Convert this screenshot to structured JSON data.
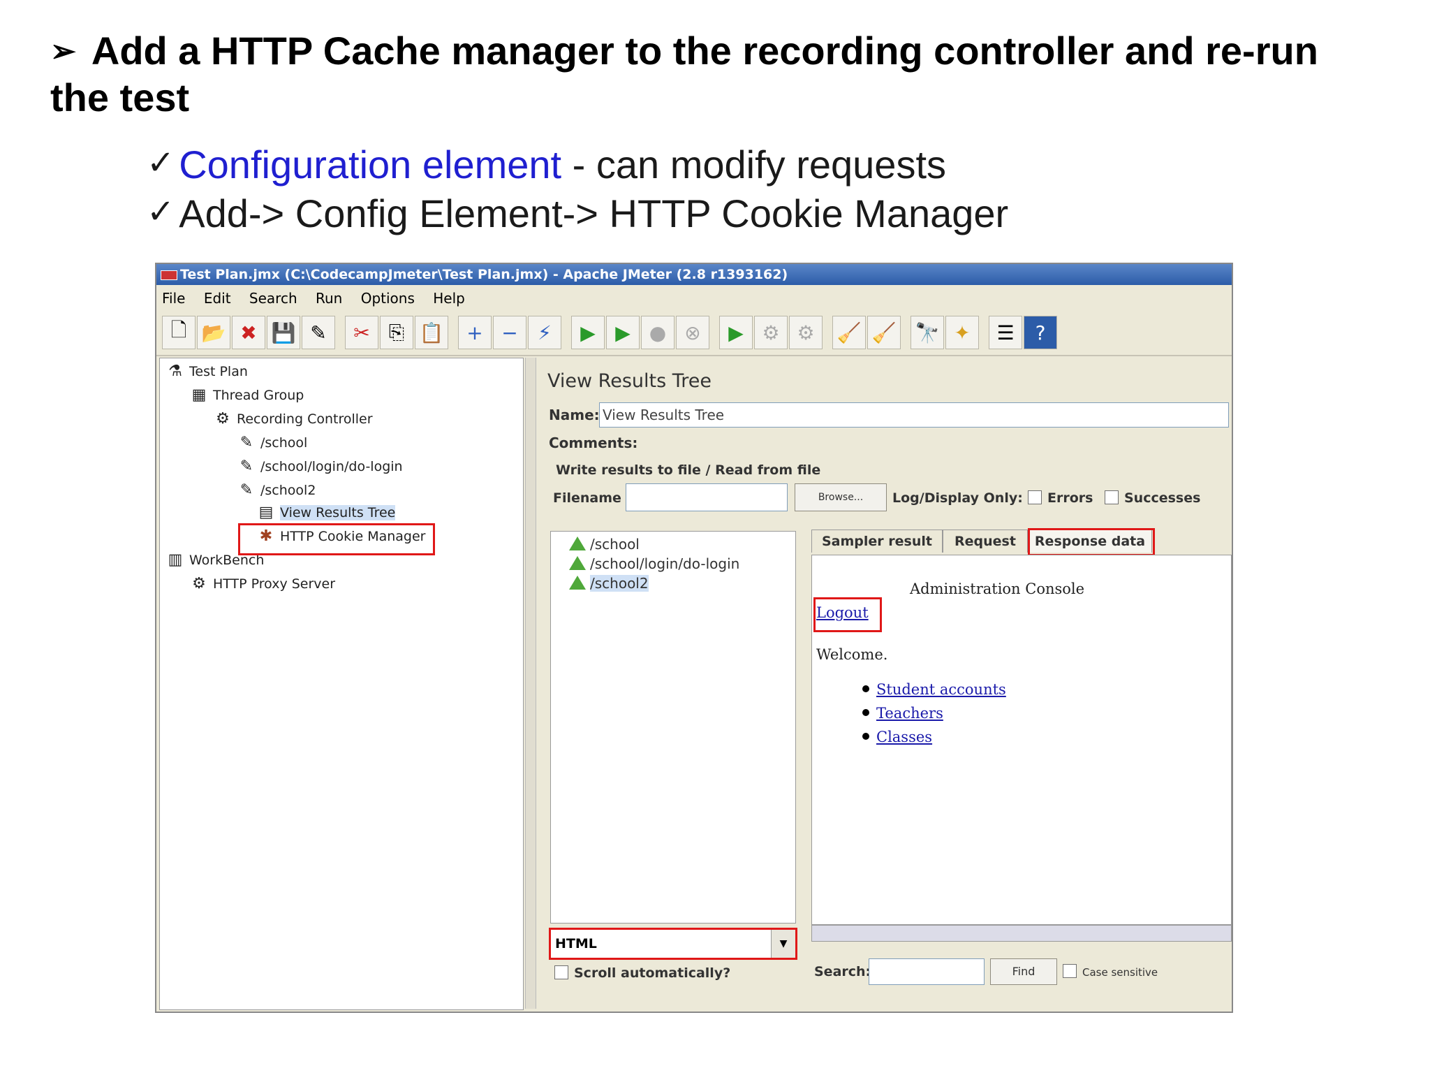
{
  "slide": {
    "heading_marker": "➢",
    "heading": "Add a HTTP Cache manager to the recording controller  and re-run the test",
    "bullets": [
      {
        "check": "✓",
        "highlight": "Configuration element",
        "rest": " - can modify requests"
      },
      {
        "check": "✓",
        "highlight": "",
        "rest": "Add-> Config Element-> HTTP Cookie Manager"
      }
    ]
  },
  "window": {
    "title": "Test Plan.jmx (C:\\CodecampJmeter\\Test Plan.jmx) - Apache JMeter (2.8 r1393162)",
    "menu": [
      "File",
      "Edit",
      "Search",
      "Run",
      "Options",
      "Help"
    ],
    "toolbar_icons": [
      "new-icon",
      "open-icon",
      "close-icon",
      "save-icon",
      "save-as-icon",
      "cut-icon",
      "copy-icon",
      "paste-icon",
      "expand-icon",
      "collapse-icon",
      "toggle-icon",
      "start-icon",
      "start-no-pause-icon",
      "stop-icon",
      "shutdown-icon",
      "remote-start-icon",
      "remote-stop-icon",
      "remote-exit-icon",
      "clear-icon",
      "clear-all-icon",
      "search-icon",
      "reset-search-icon",
      "function-helper-icon",
      "help-icon"
    ]
  },
  "tree": {
    "items": [
      {
        "label": "Test Plan",
        "icon": "flask-icon"
      },
      {
        "label": "Thread Group",
        "icon": "thread-group-icon"
      },
      {
        "label": "Recording Controller",
        "icon": "gear-icon"
      },
      {
        "label": "/school",
        "icon": "pipette-icon"
      },
      {
        "label": "/school/login/do-login",
        "icon": "pipette-icon"
      },
      {
        "label": "/school2",
        "icon": "pipette-icon"
      },
      {
        "label": "View Results Tree",
        "icon": "listener-icon"
      },
      {
        "label": "HTTP Cookie Manager",
        "icon": "cookie-icon"
      },
      {
        "label": "WorkBench",
        "icon": "workbench-icon"
      },
      {
        "label": "HTTP Proxy Server",
        "icon": "gear-icon"
      }
    ]
  },
  "panel": {
    "title": "View Results Tree",
    "name_label": "Name:",
    "name_value": "View Results Tree",
    "comments_label": "Comments:",
    "write_results_label": "Write results to file / Read from file",
    "filename_label": "Filename",
    "filename_value": "",
    "browse_button": "Browse...",
    "log_display_label": "Log/Display Only:",
    "errors_label": "Errors",
    "successes_label": "Successes",
    "results": [
      "/school",
      "/school/login/do-login",
      "/school2"
    ],
    "renderer": "HTML",
    "scroll_auto_label": "Scroll automatically?",
    "tabs": [
      "Sampler result",
      "Request",
      "Response data"
    ],
    "active_tab": "Response data",
    "response": {
      "heading": "Administration Console",
      "logout": "Logout",
      "welcome": "Welcome.",
      "links": [
        "Student accounts ",
        "Teachers ",
        "Classes "
      ]
    },
    "search_label": "Search:",
    "search_value": "",
    "find_button": "Find",
    "case_sensitive_label": "Case sensitive"
  },
  "colors": {
    "highlight_box": "#e01818",
    "bullet_highlight": "#1f1fd0",
    "title_bar": "#2c5ca8"
  }
}
